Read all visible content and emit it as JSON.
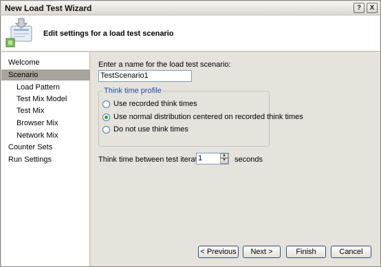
{
  "window": {
    "title": "New Load Test Wizard",
    "help_label": "?",
    "close_label": "X"
  },
  "header": {
    "title": "Edit settings for a load test scenario"
  },
  "nav": {
    "items": [
      {
        "label": "Welcome"
      },
      {
        "label": "Scenario"
      },
      {
        "label": "Load Pattern"
      },
      {
        "label": "Test Mix Model"
      },
      {
        "label": "Test Mix"
      },
      {
        "label": "Browser Mix"
      },
      {
        "label": "Network Mix"
      },
      {
        "label": "Counter Sets"
      },
      {
        "label": "Run Settings"
      }
    ],
    "selected": "Scenario"
  },
  "scenario": {
    "name_label": "Enter a name for the load test scenario:",
    "name_value": "TestScenario1"
  },
  "think_time": {
    "group_title": "Think time profile",
    "options": [
      {
        "label": "Use recorded think times",
        "checked": false
      },
      {
        "label": "Use normal distribution centered on recorded think times",
        "checked": true
      },
      {
        "label": "Do not use think times",
        "checked": false
      }
    ],
    "between_label": "Think time between test iterations:",
    "between_value": "1",
    "between_unit": "seconds"
  },
  "buttons": {
    "previous": "< Previous",
    "next": "Next >",
    "finish": "Finish",
    "cancel": "Cancel"
  },
  "colors": {
    "selected_nav": "#a9a59c",
    "group_title": "#1f4fb0",
    "radio_check": "#2fa52f"
  }
}
